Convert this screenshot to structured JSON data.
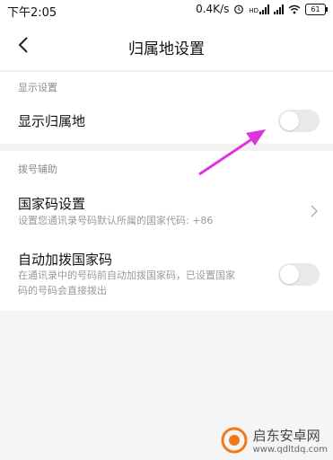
{
  "status_bar": {
    "time": "下午2:05",
    "network_speed": "0.4K/s",
    "battery": "61",
    "icons": [
      "alarm-icon",
      "signal-hd-icon",
      "signal-icon",
      "wifi-icon",
      "battery-icon"
    ]
  },
  "header": {
    "title": "归属地设置",
    "back_icon": "chevron-left-icon"
  },
  "section_display": {
    "label": "显示设置",
    "row": {
      "title": "显示归属地",
      "toggle_on": false
    }
  },
  "section_dial": {
    "label": "拨号辅助",
    "country_code": {
      "title": "国家码设置",
      "subtitle": "设置您通讯录号码默认所属的国家代码: +86"
    },
    "auto_add": {
      "title": "自动加拨国家码",
      "subtitle_line1": "在通讯录中的号码前自动加拨国家码，已设置国家",
      "subtitle_line2": "码的号码会直接拨出",
      "toggle_on": false
    }
  },
  "watermark": {
    "name": "启东安卓网",
    "url": "www.qdltdq.com"
  },
  "colors": {
    "annotation_arrow": "#e033e0",
    "toggle_off": "#e9e9e9",
    "watermark_orange": "#f07a1a"
  }
}
